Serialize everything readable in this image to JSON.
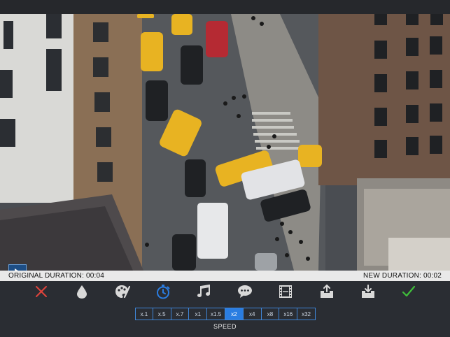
{
  "duration": {
    "original_label": "ORIGINAL DURATION: 00:04",
    "new_label": "NEW DURATION: 00:02"
  },
  "toolbar": {
    "tools": [
      {
        "name": "cancel",
        "icon": "close-icon",
        "color": "#e0443c"
      },
      {
        "name": "color-filter",
        "icon": "droplet-icon",
        "color": "#d9d9d9"
      },
      {
        "name": "effects",
        "icon": "palette-icon",
        "color": "#d9d9d9"
      },
      {
        "name": "speed",
        "icon": "stopwatch-icon",
        "color": "#2a7de1"
      },
      {
        "name": "music",
        "icon": "music-note-icon",
        "color": "#d9d9d9"
      },
      {
        "name": "text",
        "icon": "speech-bubble-icon",
        "color": "#d9d9d9"
      },
      {
        "name": "film",
        "icon": "film-strip-icon",
        "color": "#d9d9d9"
      },
      {
        "name": "insert-before",
        "icon": "tray-up-icon",
        "color": "#d9d9d9"
      },
      {
        "name": "insert-after",
        "icon": "tray-down-icon",
        "color": "#d9d9d9"
      },
      {
        "name": "confirm",
        "icon": "checkmark-icon",
        "color": "#3fbf3a"
      }
    ]
  },
  "speed": {
    "options": [
      "x.1",
      "x.5",
      "x.7",
      "x1",
      "x1.5",
      "x2",
      "x4",
      "x8",
      "x16",
      "x32"
    ],
    "selected": "x2",
    "label": "SPEED"
  },
  "colors": {
    "accent": "#2a7de1",
    "cancel": "#e0443c",
    "confirm": "#3fbf3a"
  }
}
